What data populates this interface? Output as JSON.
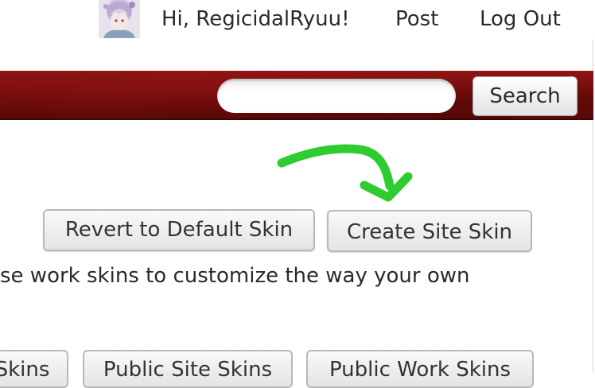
{
  "header": {
    "greeting": "Hi, RegicidalRyuu!",
    "nav": {
      "post": "Post",
      "log_out": "Log Out"
    },
    "search": {
      "placeholder": "",
      "button_label": "Search"
    }
  },
  "colors": {
    "header_bar": "#7a0f0e",
    "arrow": "#2ecc2e"
  },
  "skin_actions": {
    "revert_label": "Revert to Default Skin",
    "create_label": "Create Site Skin"
  },
  "description": "se work skins to customize the way your own",
  "tabs": [
    {
      "label": "Skins"
    },
    {
      "label": "Public Site Skins"
    },
    {
      "label": "Public Work Skins"
    }
  ]
}
